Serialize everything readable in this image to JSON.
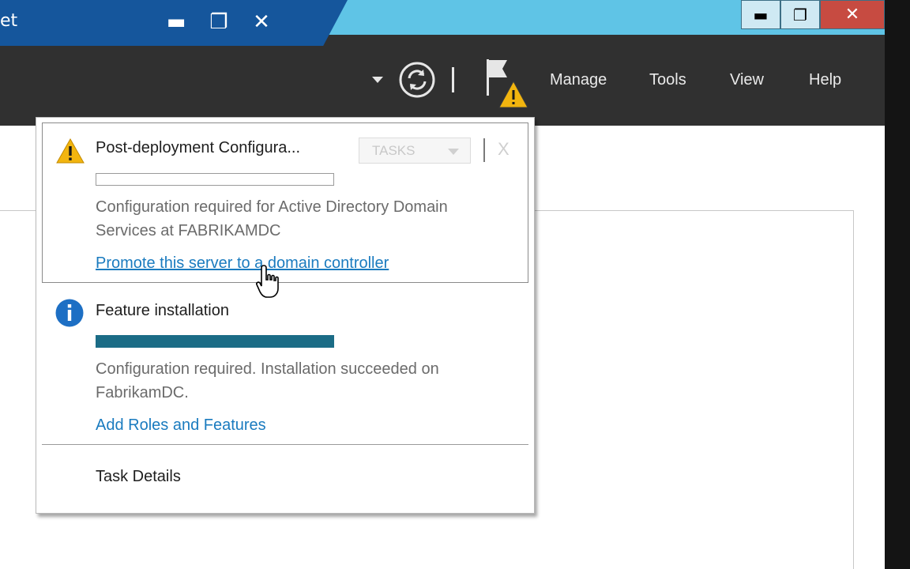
{
  "window": {
    "title_fragment": "et",
    "minimize_glyph": "▬",
    "restore_glyph": "❐",
    "close_glyph": "✕"
  },
  "outer_window": {
    "minimize_glyph": "▬",
    "restore_glyph": "❐",
    "close_glyph": "✕"
  },
  "menu": {
    "items": [
      "Manage",
      "Tools",
      "View",
      "Help"
    ]
  },
  "notifications": {
    "items": [
      {
        "title": "Post-deployment Configura...",
        "icon": "warning-icon",
        "progress": 0,
        "description": "Configuration required for Active Directory Domain Services at FABRIKAMDC",
        "link": "Promote this server to a domain controller"
      },
      {
        "title": "Feature installation",
        "icon": "info-icon",
        "progress": 1,
        "description": "Configuration required. Installation succeeded on FabrikamDC.",
        "link": "Add Roles and Features"
      }
    ],
    "tasks_label": "TASKS",
    "dismiss_glyph": "X",
    "footer_link": "Task Details"
  },
  "colors": {
    "titlebar": "#15569c",
    "outer_titlebar": "#5fc4e6",
    "command_bar": "#303030",
    "link": "#1a7bbf",
    "progress_fill": "#1b6c86",
    "warning": "#f2b50f",
    "info": "#1d6fc4"
  }
}
